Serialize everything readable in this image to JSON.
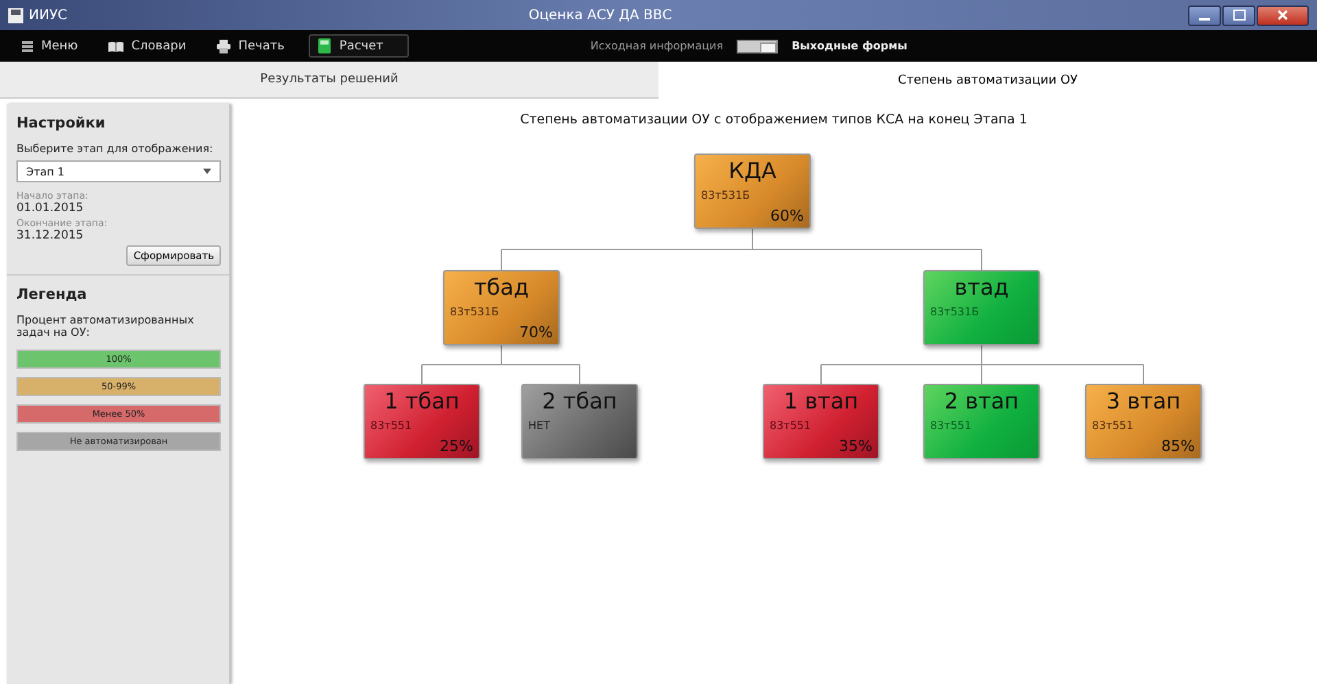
{
  "window": {
    "app_name": "ИИУС",
    "title": "Оценка АСУ ДА ВВС"
  },
  "toolbar": {
    "items": [
      {
        "kind": "menu",
        "label": "Меню"
      },
      {
        "kind": "book",
        "label": "Словари"
      },
      {
        "kind": "print",
        "label": "Печать"
      },
      {
        "kind": "calc",
        "label": "Расчет"
      }
    ],
    "toggle": {
      "left_label": "Исходная информация",
      "right_label": "Выходные формы",
      "on": true
    }
  },
  "tabs": [
    {
      "label": "Результаты решений",
      "selected": false
    },
    {
      "label": "Степень автоматизации ОУ",
      "selected": true
    }
  ],
  "settings": {
    "title": "Настройки",
    "select_label": "Выберите этап для отображения:",
    "select_value": "Этап 1",
    "start_label": "Начало этапа:",
    "start_value": "01.01.2015",
    "end_label": "Окончание этапа:",
    "end_value": "31.12.2015",
    "button": "Сформировать"
  },
  "legend": {
    "title": "Легенда",
    "caption": "Процент автоматизированных задач на ОУ:",
    "items": [
      {
        "kind": "full",
        "label": "100%"
      },
      {
        "kind": "partial",
        "label": "50-99%"
      },
      {
        "kind": "low",
        "label": "Менее 50%"
      },
      {
        "kind": "none",
        "label": "Не автоматизирован"
      }
    ]
  },
  "chart_title": "Степень автоматизации ОУ с отображением типов КСА на конец Этапа 1",
  "tree": {
    "name": "КДА",
    "code": "83т531Б",
    "percent": "60%",
    "kind": "partial",
    "children": [
      {
        "name": "тбад",
        "code": "83т531Б",
        "percent": "70%",
        "kind": "partial",
        "children": [
          {
            "name": "1 тбап",
            "code": "83т551",
            "percent": "25%",
            "kind": "low"
          },
          {
            "name": "2 тбап",
            "code": "НЕТ",
            "kind": "none"
          }
        ]
      },
      {
        "name": "втад",
        "code": "83т531Б",
        "kind": "full",
        "children": [
          {
            "name": "1 втап",
            "code": "83т551",
            "percent": "35%",
            "kind": "low"
          },
          {
            "name": "2 втап",
            "code": "83т551",
            "kind": "full"
          },
          {
            "name": "3 втап",
            "code": "83т551",
            "percent": "85%",
            "kind": "partial"
          }
        ]
      }
    ]
  }
}
